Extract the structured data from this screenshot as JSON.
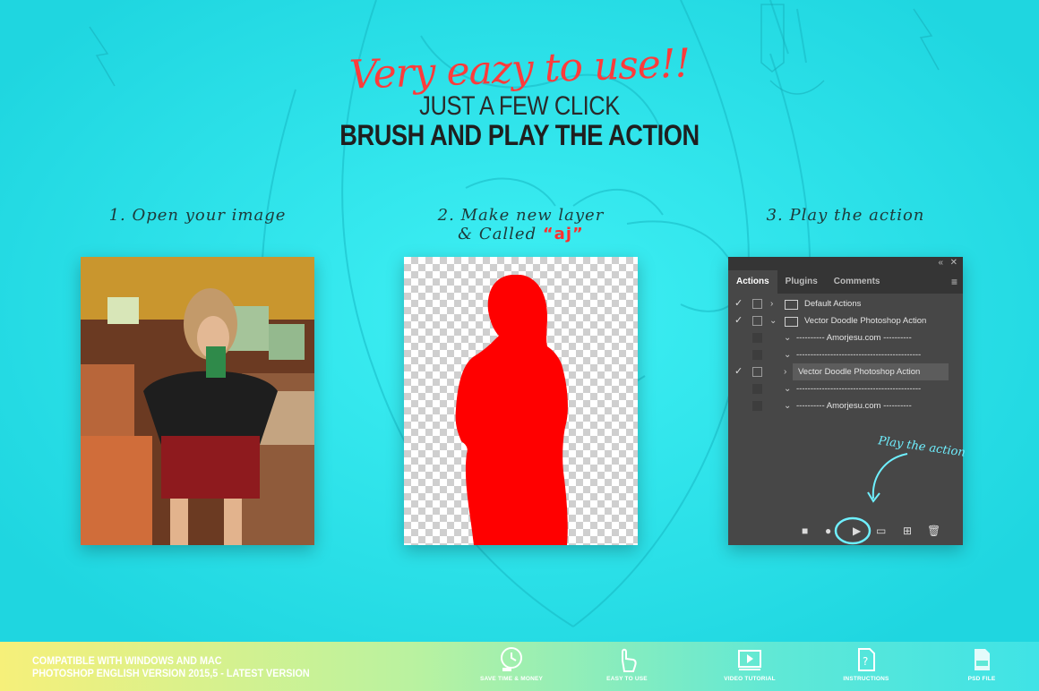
{
  "headline": {
    "script": "Very eazy to use!!",
    "line1": "JUST A FEW CLICK",
    "line2": "BRUSH AND PLAY THE ACTION"
  },
  "steps": [
    {
      "label": "1. Open your image"
    },
    {
      "label_a": "2. Make new layer",
      "label_b": "& Called ",
      "layer_name": "“aj”"
    },
    {
      "label": "3. Play the action"
    }
  ],
  "actions_panel": {
    "tabs": [
      "Actions",
      "Plugins",
      "Comments"
    ],
    "active_tab": "Actions",
    "rows": [
      {
        "text": "Default Actions",
        "checked": true,
        "type": "set"
      },
      {
        "text": "Vector Doodle Photoshop Action",
        "checked": true,
        "type": "set-open"
      },
      {
        "text": "---------- Amorjesu.com ----------",
        "checked": false,
        "type": "step"
      },
      {
        "text": "--------------------------------------------",
        "checked": false,
        "type": "step"
      },
      {
        "text": "Vector Doodle Photoshop Action",
        "checked": true,
        "type": "action-selected"
      },
      {
        "text": "--------------------------------------------",
        "checked": false,
        "type": "step"
      },
      {
        "text": "---------- Amorjesu.com ----------",
        "checked": false,
        "type": "step"
      }
    ],
    "annotation": "Play the action"
  },
  "footer": {
    "compat_line1": "COMPATIBLE WITH WINDOWS AND MAC",
    "compat_line2": "PHOTOSHOP ENGLISH VERSION 2015,5 - LATEST VERSION",
    "features": [
      {
        "label": "SAVE TIME & MONEY",
        "icon": "clock-money-icon"
      },
      {
        "label": "EASY TO USE",
        "icon": "hand-click-icon"
      },
      {
        "label": "VIDEO TUTORIAL",
        "icon": "video-play-icon"
      },
      {
        "label": "INSTRUCTIONS",
        "icon": "document-help-icon"
      },
      {
        "label": "PSD FILE",
        "icon": "psd-file-icon"
      }
    ]
  },
  "colors": {
    "background": "#22dde6",
    "accent_red": "#ff3b3b",
    "silhouette": "#ff0000",
    "panel_bg": "#474747"
  }
}
